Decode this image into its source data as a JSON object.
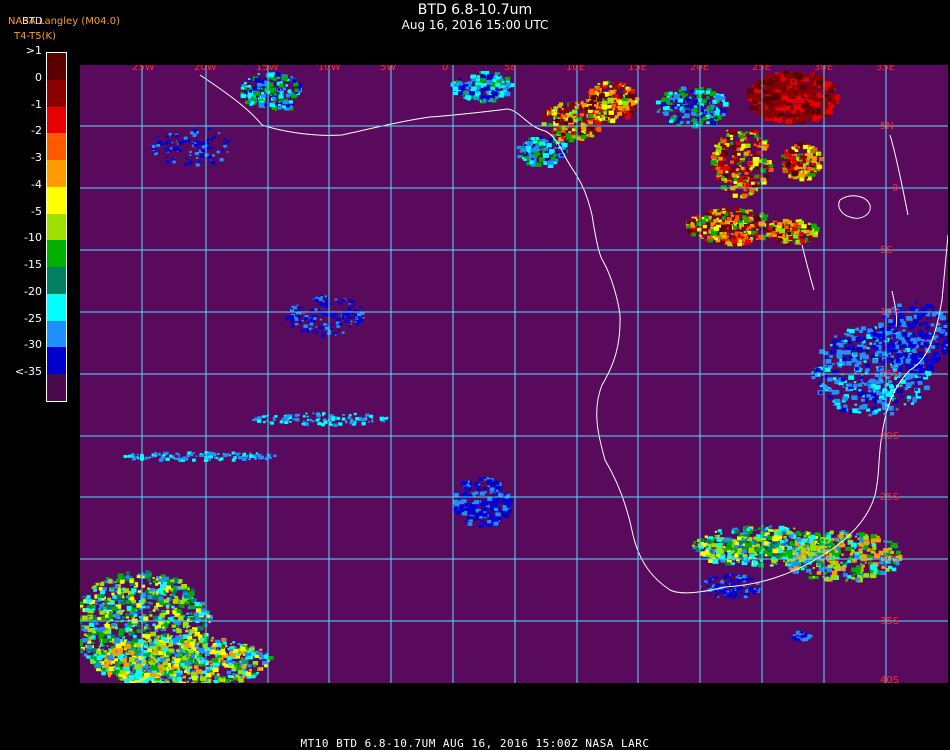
{
  "header": {
    "title": "BTD 6.8-10.7um",
    "subtitle": "Aug 16, 2016 15:00 UTC"
  },
  "corner": {
    "source": "NASA Langley (M04.0)",
    "product": "BTD",
    "formula": "T4-T5(K)"
  },
  "legend": {
    "labels": [
      ">1",
      "0",
      "-1",
      "-2",
      "-3",
      "-4",
      "-5",
      "-10",
      "-15",
      "-20",
      "-25",
      "-30",
      "<-35"
    ],
    "colors": [
      "#5a0000",
      "#8b0000",
      "#e60000",
      "#ff5a00",
      "#ff9a00",
      "#ffff00",
      "#a0e000",
      "#00b000",
      "#008060",
      "#00ffff",
      "#1e90ff",
      "#0000cc",
      "#4b0a4b"
    ]
  },
  "map": {
    "background": "#5a0a5c",
    "grid_color": "#49e2ff",
    "coast_color": "#ffffff",
    "lon_labels": [
      "25W",
      "20W",
      "15W",
      "10W",
      "5W",
      "0",
      "5E",
      "10E",
      "15E",
      "20E",
      "25E",
      "30E",
      "35E"
    ],
    "lat_labels": [
      "5N",
      "0",
      "5S",
      "10S",
      "15S",
      "20S",
      "25S",
      "30S",
      "35S",
      "40S"
    ]
  },
  "footer": {
    "text": "MT10  BTD 6.8-10.7UM   AUG 16, 2016 15:00Z  NASA LARC"
  }
}
